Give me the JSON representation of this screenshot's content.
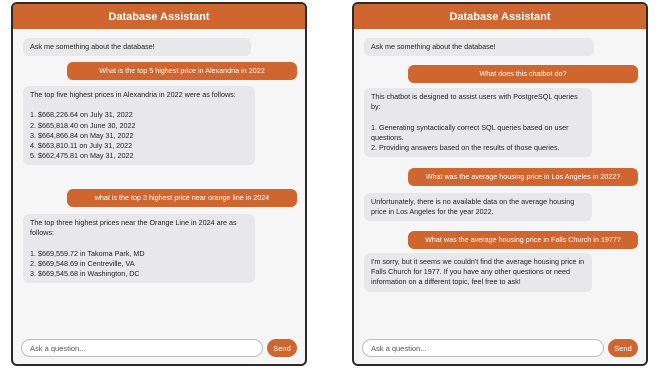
{
  "left_chat": {
    "title": "Database Assistant",
    "messages": [
      {
        "role": "bot",
        "text": "Ask me something about the database!"
      },
      {
        "role": "user",
        "text": "What is the top 5 highest price in Alexandria in 2022"
      },
      {
        "role": "bot",
        "text": "The top five highest prices in Alexandria in 2022 were as follows:\n\n1. $668,226.64 on July 31, 2022\n2. $665,818.40 on June 30, 2022\n3. $664,866.84 on May 31, 2022\n4. $663,810.11 on July 31, 2022\n5. $662,475.81 on May 31, 2022"
      },
      {
        "role": "user",
        "text": "what is the top 3 highest price near orange line in 2024"
      },
      {
        "role": "bot",
        "text": "The top three highest prices near the Orange Line in 2024 are as follows:\n\n1. $669,559.72 in Takoma Park, MD\n2. $669,548.69 in Centreville, VA\n3. $669,545.68 in Washington, DC"
      }
    ],
    "input_placeholder": "Ask a question...",
    "send_label": "Send"
  },
  "right_chat": {
    "title": "Database Assistant",
    "messages": [
      {
        "role": "bot",
        "text": "Ask me something about the database!"
      },
      {
        "role": "user",
        "text": "What does this chatbot do?"
      },
      {
        "role": "bot",
        "text": "This chatbot is designed to assist users with PostgreSQL queries by:\n\n1. Generating syntactically correct SQL queries based on user questions.\n2. Providing answers based on the results of those queries."
      },
      {
        "role": "user",
        "text": "What was the average housing price in Los Angeles in 2022?"
      },
      {
        "role": "bot",
        "text": "Unfortunately, there is no available data on the average housing price in Los Angeles for the year 2022."
      },
      {
        "role": "user",
        "text": "What was the average housing price in Falls Church in 1977?"
      },
      {
        "role": "bot",
        "text": "I'm sorry, but it seems we couldn't find the average housing price in Falls Church for 1977. If you have any other questions or need information on a different topic, feel free to ask!"
      }
    ],
    "input_placeholder": "Ask a question...",
    "send_label": "Send"
  },
  "colors": {
    "accent": "#cf6630",
    "bot_bubble": "#e8e8ea",
    "panel_bg": "#f6f6f6"
  }
}
